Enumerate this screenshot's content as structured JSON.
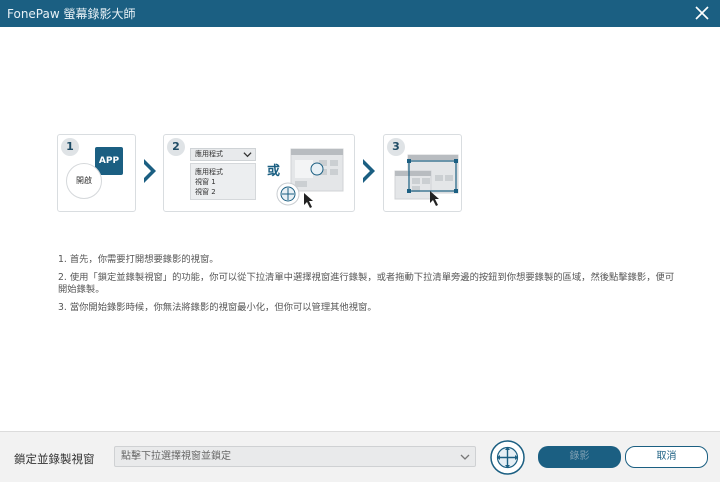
{
  "window": {
    "title": "FonePaw 螢幕錄影大師"
  },
  "steps": {
    "step1": {
      "number": "1",
      "app_label": "APP",
      "open_label": "開啟"
    },
    "step2": {
      "number": "2",
      "dropdown_selected": "應用程式",
      "list_items": [
        "應用程式",
        "視窗 1",
        "視窗 2"
      ],
      "or_label": "或"
    },
    "step3": {
      "number": "3"
    }
  },
  "instructions": [
    "1. 首先，你需要打開想要錄影的視窗。",
    "2. 使用「鎖定並錄製視窗」的功能，你可以從下拉清單中選擇視窗進行錄製，或者拖動下拉清單旁邊的按鈕到你想要錄製的區域，然後點擊錄影，便可開始錄製。",
    "3. 當你開始錄影時候，你無法將錄影的視窗最小化，但你可以管理其他視窗。"
  ],
  "bottom": {
    "lock_label": "鎖定並錄製視窗",
    "select_placeholder": "點擊下拉選擇視窗並鎖定",
    "record_label": "錄影",
    "cancel_label": "取消"
  },
  "colors": {
    "accent": "#1b5f82",
    "titlebar": "#1b5f82"
  }
}
